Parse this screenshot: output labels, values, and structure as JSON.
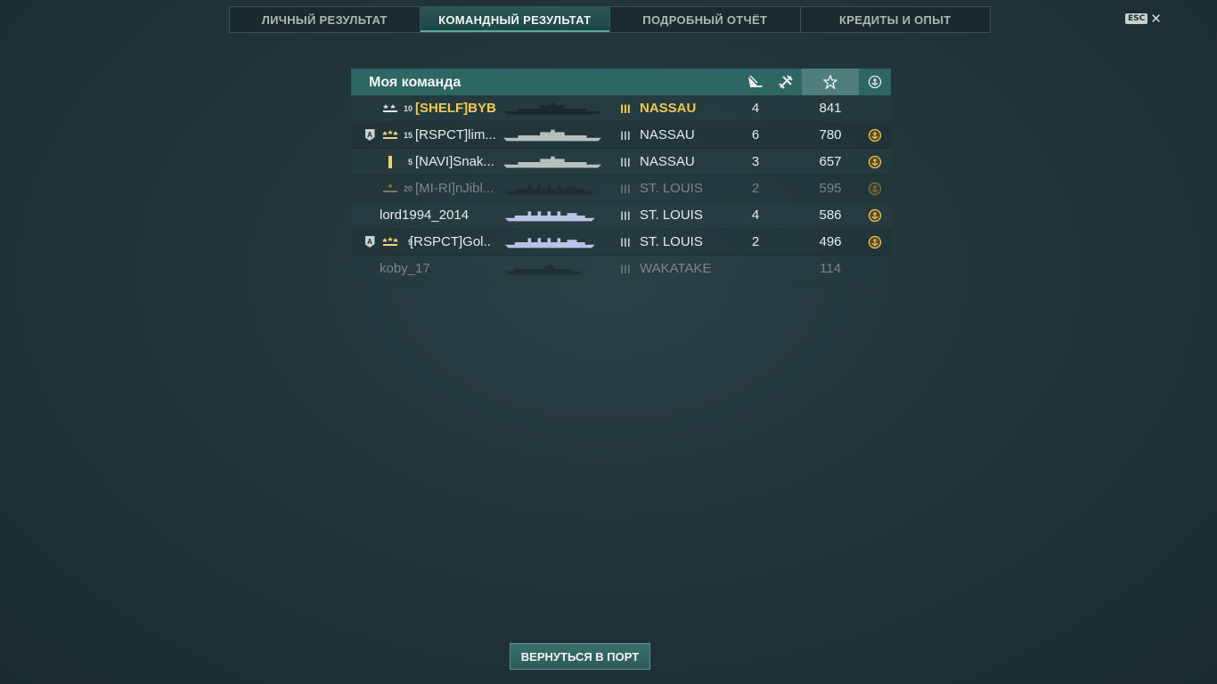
{
  "tabs": [
    {
      "label": "ЛИЧНЫЙ РЕЗУЛЬТАТ",
      "active": false
    },
    {
      "label": "КОМАНДНЫЙ РЕЗУЛЬТАТ",
      "active": true
    },
    {
      "label": "ПОДРОБНЫЙ ОТЧЁТ",
      "active": false
    },
    {
      "label": "КРЕДИТЫ И ОПЫТ",
      "active": false
    }
  ],
  "close": {
    "esc_label": "ESC",
    "icon": "close-icon"
  },
  "team": {
    "title": "Моя команда",
    "columns": {
      "kills_icon": "ships-destroyed-icon",
      "planes_icon": "planes-destroyed-icon",
      "xp_icon": "star-icon",
      "medal_icon": "anchor-medal-icon"
    },
    "rows": [
      {
        "badge": "",
        "rank_icon": "rank-two-stars",
        "level": "10",
        "name": "[SHELF]BYB...",
        "ship_color": "#1a2a2c",
        "tier": "III",
        "ship": "NASSAU",
        "kills": "4",
        "xp": "841",
        "medal": false,
        "highlight": true,
        "dead": false
      },
      {
        "badge": "A",
        "rank_icon": "rank-three-stars",
        "level": "15",
        "name": "[RSPCT]lim...",
        "ship_color": "#b7bfbd",
        "tier": "III",
        "ship": "NASSAU",
        "kills": "6",
        "xp": "780",
        "medal": true,
        "highlight": false,
        "dead": false
      },
      {
        "badge": "",
        "rank_icon": "rank-bar",
        "level": "5",
        "name": "[NAVI]Snak...",
        "ship_color": "#b7bfbd",
        "tier": "III",
        "ship": "NASSAU",
        "kills": "3",
        "xp": "657",
        "medal": true,
        "highlight": false,
        "dead": false
      },
      {
        "badge": "",
        "rank_icon": "rank-one-star",
        "level": "20",
        "name": "[MI-RI]nJibl...",
        "ship_color": "#1a2a2c",
        "tier": "III",
        "ship": "ST. LOUIS",
        "kills": "2",
        "xp": "595",
        "medal": true,
        "highlight": false,
        "dead": true
      },
      {
        "badge": "",
        "rank_icon": "",
        "level": "",
        "name": "lord1994_2014",
        "ship_color": "#b9c4e6",
        "tier": "III",
        "ship": "ST. LOUIS",
        "kills": "4",
        "xp": "586",
        "medal": true,
        "highlight": false,
        "dead": false
      },
      {
        "badge": "A",
        "rank_icon": "rank-three-stars",
        "level": "9",
        "name": "[RSPCT]Gol...",
        "ship_color": "#b9c4e6",
        "tier": "III",
        "ship": "ST. LOUIS",
        "kills": "2",
        "xp": "496",
        "medal": true,
        "highlight": false,
        "dead": false
      },
      {
        "badge": "",
        "rank_icon": "",
        "level": "",
        "name": "koby_17",
        "ship_color": "#1a2a2c",
        "tier": "III",
        "ship": "WAKATAKE",
        "kills": "",
        "xp": "114",
        "medal": false,
        "highlight": false,
        "dead": true
      }
    ]
  },
  "footer": {
    "return_label": "ВЕРНУТЬСЯ В ПОРТ"
  }
}
